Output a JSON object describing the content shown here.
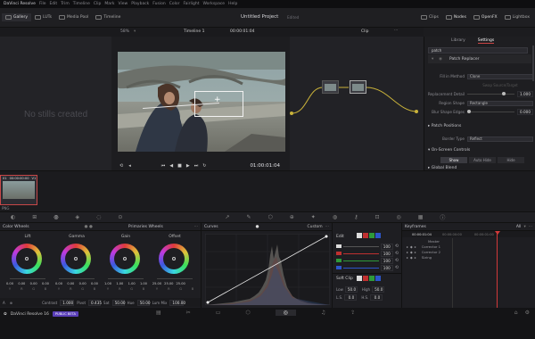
{
  "menubar": {
    "items": [
      "DaVinci Resolve",
      "File",
      "Edit",
      "Trim",
      "Timeline",
      "Clip",
      "Mark",
      "View",
      "Playback",
      "Fusion",
      "Color",
      "Fairlight",
      "Workspace",
      "Help"
    ]
  },
  "toolbar": {
    "left": [
      "Gallery",
      "LUTs",
      "Media Pool",
      "Timeline"
    ],
    "project_title": "Untitled Project",
    "project_status": "Edited",
    "right": [
      "Clips",
      "Nodes",
      "OpenFX",
      "Lightbox"
    ]
  },
  "viewer": {
    "zoom": "58%",
    "timeline_name": "Timeline 1",
    "timecode_top": "00:00:01:04",
    "mode": "Clip",
    "timecode": "01:00:01:04"
  },
  "gallery": {
    "empty_message": "No stills created"
  },
  "inspector": {
    "tabs": [
      "Library",
      "Settings"
    ],
    "search": "patch",
    "effect_name": "Patch Replacer",
    "rows": [
      {
        "label": "Fill in Method",
        "value": "Clone"
      },
      {
        "label": "",
        "value": "Swap Source/Target"
      },
      {
        "label": "Replacement Detail",
        "value": "1.000"
      },
      {
        "label": "Region Shape",
        "value": "Rectangle"
      },
      {
        "label": "Blur Shape Edges",
        "value": "0.000"
      }
    ],
    "section_patch_positions": "Patch Positions",
    "border_type_label": "Border Type",
    "border_type_value": "Reflect",
    "section_onscreen": "On-Screen Controls",
    "onscreen_buttons": [
      "Show",
      "Auto Hide",
      "Hide"
    ],
    "section_global_blend": "Global Blend"
  },
  "strip": {
    "clip_index": "01",
    "clip_timecode": "00:00:00:00",
    "clip_track": "V1",
    "clip_codec": "PNG"
  },
  "color_wheels": {
    "title": "Color Wheels",
    "mode": "Primaries Wheels",
    "wheels": [
      {
        "name": "Lift",
        "values": [
          "0.00",
          "0.00",
          "0.00",
          "0.00"
        ]
      },
      {
        "name": "Gamma",
        "values": [
          "0.00",
          "0.00",
          "0.00",
          "0.00"
        ]
      },
      {
        "name": "Gain",
        "values": [
          "1.00",
          "1.00",
          "1.00",
          "1.00"
        ]
      },
      {
        "name": "Offset",
        "values": [
          "25.00",
          "25.00",
          "25.00",
          ""
        ]
      }
    ],
    "channel_labels": [
      "Y",
      "R",
      "G",
      "B"
    ],
    "footer": [
      {
        "label": "Contrast",
        "value": "1.000"
      },
      {
        "label": "Pivot",
        "value": "0.435"
      },
      {
        "label": "Sat",
        "value": "50.00"
      },
      {
        "label": "Hue",
        "value": "50.00"
      },
      {
        "label": "Lum Mix",
        "value": "100.00"
      }
    ]
  },
  "curves": {
    "title": "Curves",
    "mode": "Custom"
  },
  "curve_tools": {
    "edit_label": "Edit",
    "values": [
      "100",
      "100",
      "100",
      "100"
    ],
    "soft_clip_label": "Soft Clip",
    "low_label": "Low",
    "low_value": "50.0",
    "high_label": "High",
    "high_value": "50.0",
    "ls_label": "L.S.",
    "ls_value": "0.0",
    "hs_label": "H.S.",
    "hs_value": "0.0"
  },
  "keyframes": {
    "title": "Keyframes",
    "filter": "All",
    "timecode": "00:00:01:04",
    "col1": "00:00:00:00",
    "col2": "00:00:01:00",
    "tracks": [
      "Master",
      "Corrector 1",
      "Corrector 2",
      "Sizing"
    ]
  },
  "bottombar": {
    "app": "DaVinci Resolve 16",
    "badge": "PUBLIC BETA"
  },
  "colors": {
    "accent_red": "#d23a3a",
    "yellow_node_line": "#c9b23a",
    "curve_white": "#e6e6e6"
  }
}
